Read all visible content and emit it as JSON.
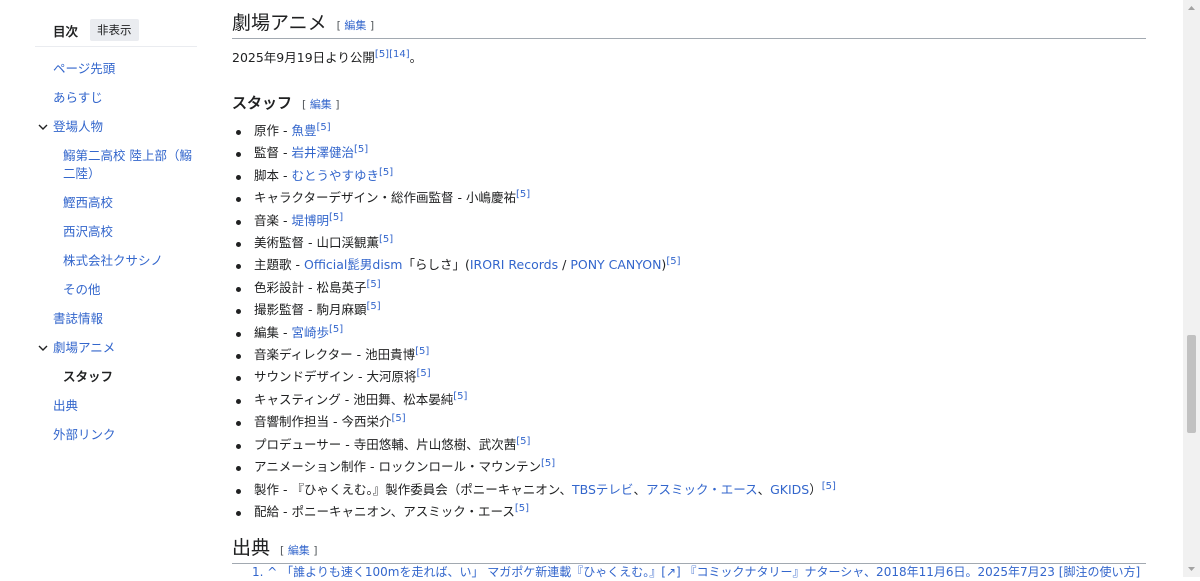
{
  "toc": {
    "title": "目次",
    "hide_label": "非表示",
    "items": [
      {
        "label": "ページ先頭",
        "level": 1
      },
      {
        "label": "あらすじ",
        "level": 1
      },
      {
        "label": "登場人物",
        "level": 1,
        "expanded": true
      },
      {
        "label": "鰯第二高校 陸上部（鰯",
        "label2": "二陸）",
        "level": 2
      },
      {
        "label": "鰹西高校",
        "level": 2
      },
      {
        "label": "西沢高校",
        "level": 2
      },
      {
        "label": "株式会社クサシノ",
        "level": 2
      },
      {
        "label": "その他",
        "level": 2
      },
      {
        "label": "書誌情報",
        "level": 1
      },
      {
        "label": "劇場アニメ",
        "level": 1,
        "expanded": true
      },
      {
        "label": "スタッフ",
        "level": 2,
        "active": true
      },
      {
        "label": "出典",
        "level": 1
      },
      {
        "label": "外部リンク",
        "level": 1
      }
    ]
  },
  "section_anime": {
    "heading": "劇場アニメ",
    "edit_label": "編集",
    "release_text": "2025年9月19日より公開",
    "release_refs": [
      "[5]",
      "[14]"
    ],
    "release_end": "。"
  },
  "section_staff": {
    "heading": "スタッフ",
    "edit_label": "編集",
    "items": [
      {
        "role": "原作",
        "parts": [
          {
            "t": "魚豊",
            "link": true
          }
        ],
        "ref": "[5]"
      },
      {
        "role": "監督",
        "parts": [
          {
            "t": "岩井澤健治",
            "link": true
          }
        ],
        "ref": "[5]"
      },
      {
        "role": "脚本",
        "parts": [
          {
            "t": "むとうやすゆき",
            "link": true
          }
        ],
        "ref": "[5]"
      },
      {
        "role": "キャラクターデザイン・総作画監督",
        "parts": [
          {
            "t": "小嶋慶祐",
            "link": false
          }
        ],
        "ref": "[5]"
      },
      {
        "role": "音楽",
        "parts": [
          {
            "t": "堤博明",
            "link": true
          }
        ],
        "ref": "[5]"
      },
      {
        "role": "美術監督",
        "parts": [
          {
            "t": "山口渓観薫",
            "link": false
          }
        ],
        "ref": "[5]"
      },
      {
        "role": "主題歌",
        "parts": [
          {
            "t": "Official髭男dism",
            "link": true
          },
          {
            "t": "「らしさ」(",
            "link": false
          },
          {
            "t": "IRORI Records",
            "link": true
          },
          {
            "t": " / ",
            "link": false
          },
          {
            "t": "PONY CANYON",
            "link": true
          },
          {
            "t": ")",
            "link": false
          }
        ],
        "ref": "[5]"
      },
      {
        "role": "色彩設計",
        "parts": [
          {
            "t": "松島英子",
            "link": false
          }
        ],
        "ref": "[5]"
      },
      {
        "role": "撮影監督",
        "parts": [
          {
            "t": "駒月麻顕",
            "link": false
          }
        ],
        "ref": "[5]"
      },
      {
        "role": "編集",
        "parts": [
          {
            "t": "宮崎歩",
            "link": true
          }
        ],
        "ref": "[5]"
      },
      {
        "role": "音楽ディレクター",
        "parts": [
          {
            "t": "池田貴博",
            "link": false
          }
        ],
        "ref": "[5]"
      },
      {
        "role": "サウンドデザイン",
        "parts": [
          {
            "t": "大河原将",
            "link": false
          }
        ],
        "ref": "[5]"
      },
      {
        "role": "キャスティング",
        "parts": [
          {
            "t": "池田舞、松本晏純",
            "link": false
          }
        ],
        "ref": "[5]"
      },
      {
        "role": "音響制作担当",
        "parts": [
          {
            "t": "今西栄介",
            "link": false
          }
        ],
        "ref": "[5]"
      },
      {
        "role": "プロデューサー",
        "parts": [
          {
            "t": "寺田悠輔、片山悠樹、武次茜",
            "link": false
          }
        ],
        "ref": "[5]"
      },
      {
        "role": "アニメーション制作",
        "parts": [
          {
            "t": "ロックンロール・マウンテン",
            "link": false
          }
        ],
        "ref": "[5]"
      },
      {
        "role": "製作",
        "parts": [
          {
            "t": "『ひゃくえむ。』製作委員会（ポニーキャニオン、",
            "link": false
          },
          {
            "t": "TBSテレビ",
            "link": true
          },
          {
            "t": "、",
            "link": false
          },
          {
            "t": "アスミック・エース",
            "link": true
          },
          {
            "t": "、",
            "link": false
          },
          {
            "t": "GKIDS",
            "link": true
          },
          {
            "t": "）",
            "link": false
          }
        ],
        "ref": "[5]"
      },
      {
        "role": "配給",
        "parts": [
          {
            "t": "ポニーキャニオン、アスミック・エース",
            "link": false
          }
        ],
        "ref": "[5]"
      }
    ]
  },
  "section_refs": {
    "heading": "出典",
    "edit_label": "編集",
    "first_line": "1. ^ 「誰よりも速く100mを走れば、い」 マガポケ新連載『ひゃくえむ。』[↗] 『コミックナタリー』ナターシャ、2018年11月6日。2025年7月23 [脚注の使い方]"
  }
}
